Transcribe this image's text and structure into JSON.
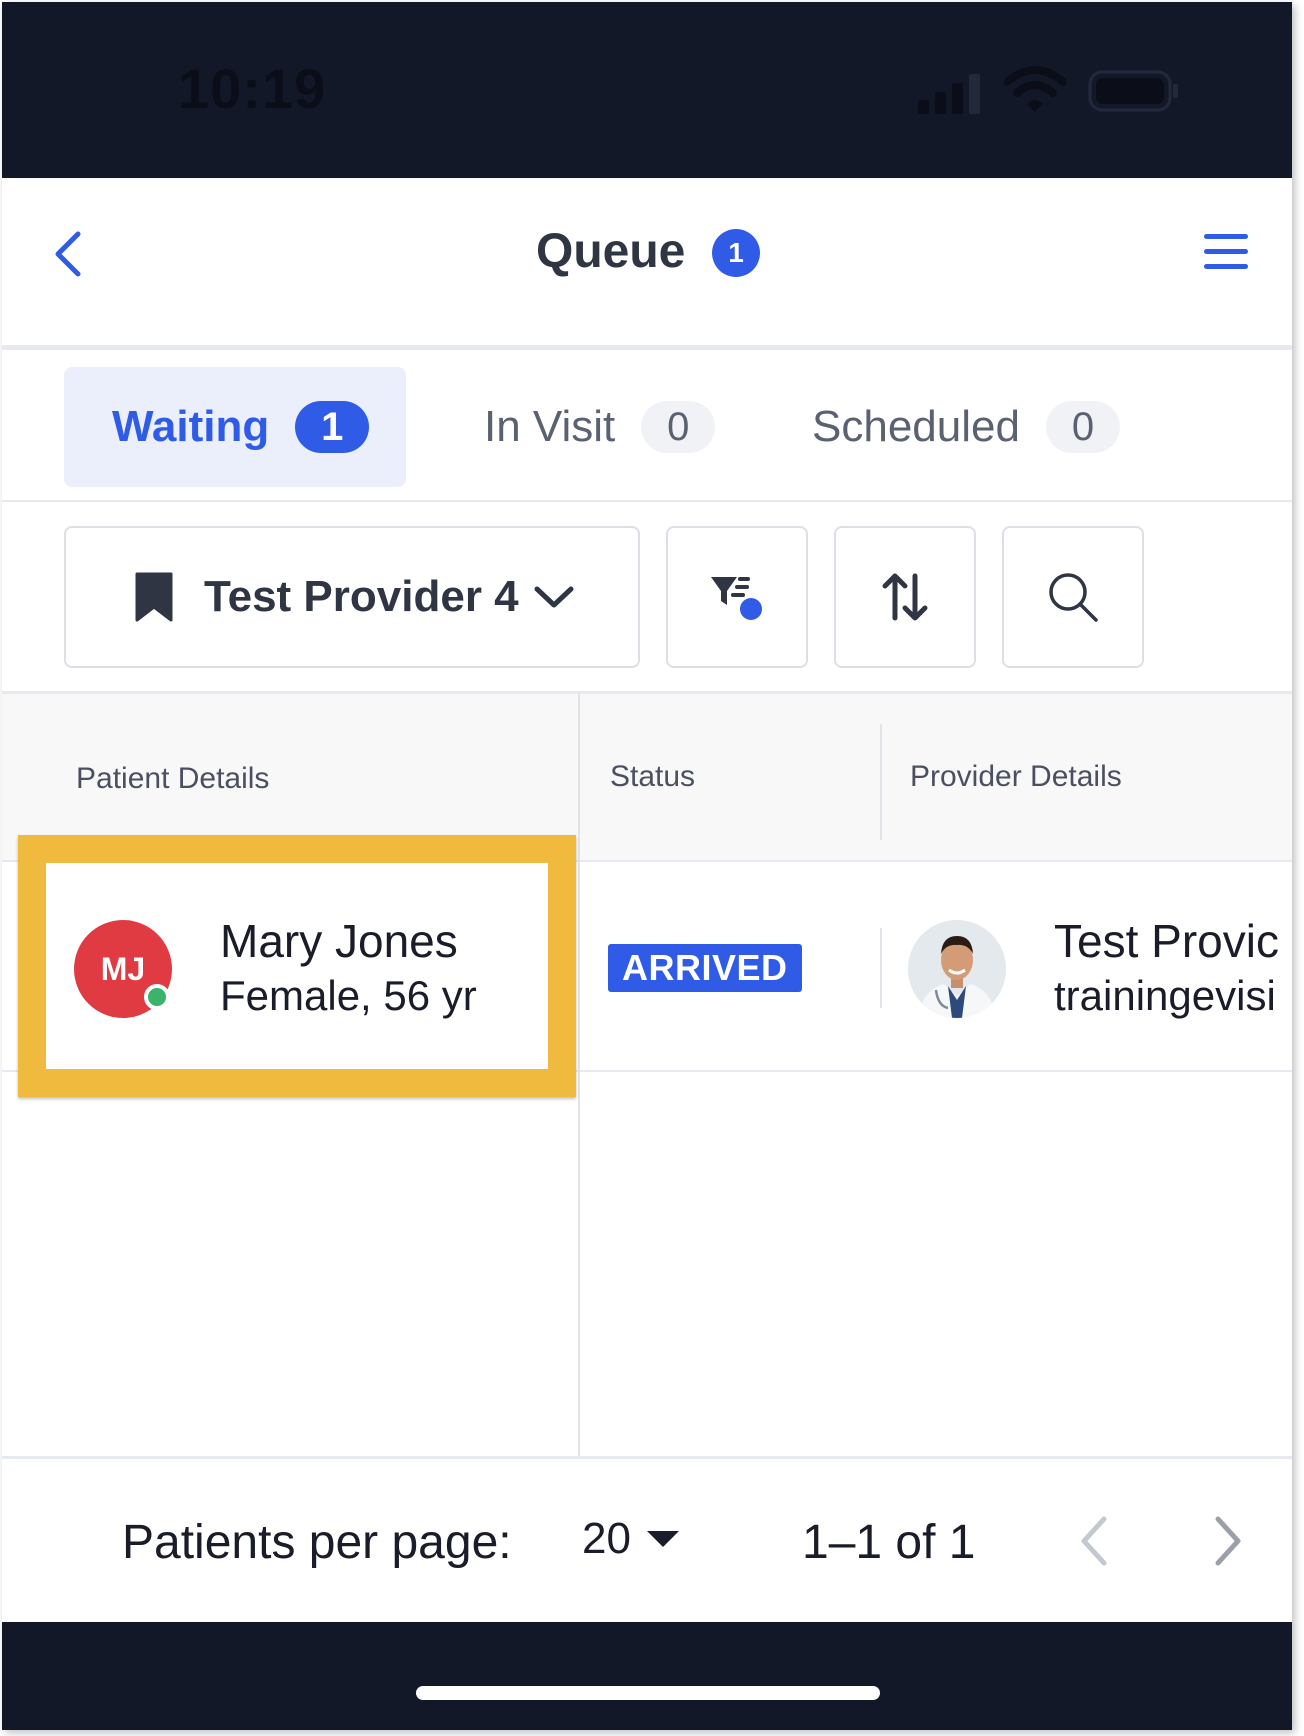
{
  "status_bar": {
    "time": "10:19"
  },
  "header": {
    "title": "Queue",
    "badge": "1"
  },
  "tabs": [
    {
      "label": "Waiting",
      "count": "1",
      "active": true
    },
    {
      "label": "In Visit",
      "count": "0",
      "active": false
    },
    {
      "label": "Scheduled",
      "count": "0",
      "active": false
    }
  ],
  "toolbar": {
    "provider": "Test Provider 4"
  },
  "table": {
    "columns": [
      "Patient Details",
      "Status",
      "Provider Details"
    ],
    "rows": [
      {
        "patient_initials": "MJ",
        "patient_name": "Mary Jones",
        "patient_meta": "Female, 56 yr",
        "status": "ARRIVED",
        "provider_name": "Test Provic",
        "provider_email": "trainingevisi"
      }
    ]
  },
  "footer": {
    "per_page_label": "Patients per page:",
    "per_page_value": "20",
    "range": "1–1 of 1"
  },
  "colors": {
    "accent": "#2f5be6",
    "highlight": "#f0ba3e",
    "avatar": "#e03b43",
    "presence": "#3bb36a",
    "status_bar": "#131829"
  }
}
